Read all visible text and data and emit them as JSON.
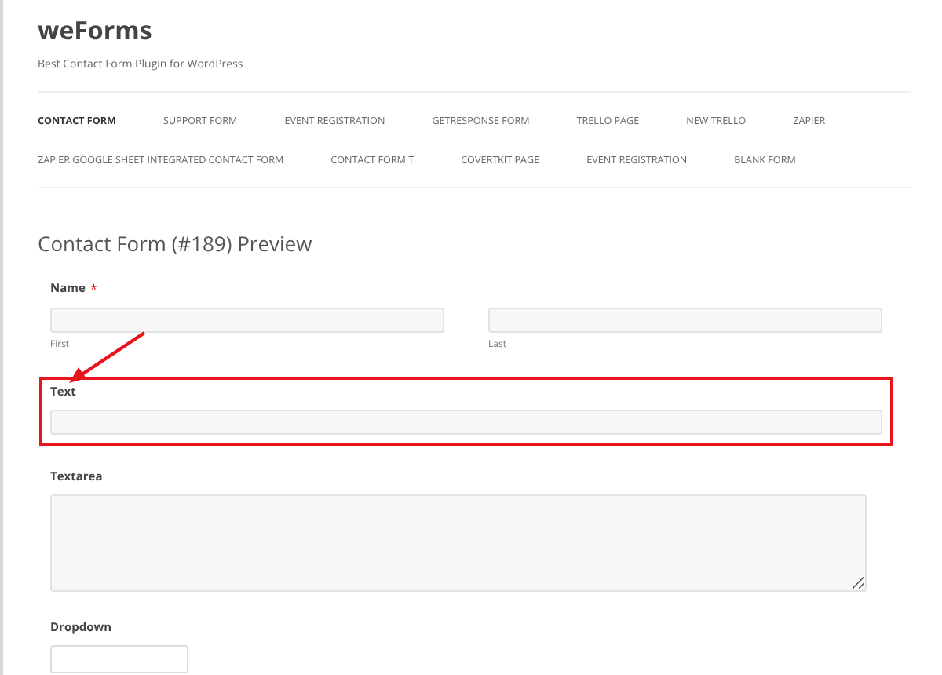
{
  "site": {
    "title": "weForms",
    "tagline": "Best Contact Form Plugin for WordPress"
  },
  "nav": {
    "items": [
      {
        "label": "CONTACT FORM",
        "selected": true
      },
      {
        "label": "SUPPORT FORM",
        "selected": false
      },
      {
        "label": "EVENT REGISTRATION",
        "selected": false
      },
      {
        "label": "GETRESPONSE FORM",
        "selected": false
      },
      {
        "label": "TRELLO PAGE",
        "selected": false
      },
      {
        "label": "NEW TRELLO",
        "selected": false
      },
      {
        "label": "ZAPIER",
        "selected": false
      },
      {
        "label": "ZAPIER GOOGLE SHEET INTEGRATED CONTACT FORM",
        "selected": false
      },
      {
        "label": "CONTACT FORM T",
        "selected": false
      },
      {
        "label": "COVERTKIT PAGE",
        "selected": false
      },
      {
        "label": "EVENT REGISTRATION",
        "selected": false
      },
      {
        "label": "BLANK FORM",
        "selected": false
      }
    ]
  },
  "page_title": "Contact Form (#189) Preview",
  "fields": [
    {
      "kind": "name",
      "label": "Name",
      "required_mark": "*",
      "highlighted": false,
      "sublabels": [
        "First",
        "Last"
      ]
    },
    {
      "kind": "text",
      "label": "Text",
      "highlighted": true
    },
    {
      "kind": "textarea",
      "label": "Textarea",
      "highlighted": false
    },
    {
      "kind": "dropdown",
      "label": "Dropdown",
      "highlighted": false
    }
  ]
}
